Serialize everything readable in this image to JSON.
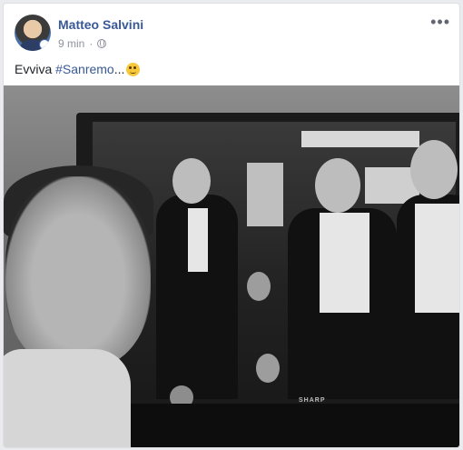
{
  "post": {
    "author": "Matteo Salvini",
    "time": "9 min",
    "separator": "·",
    "privacy_icon": "globe-icon",
    "more_icon": "more-options-icon",
    "text_before": "Evviva ",
    "hashtag": "#Sanremo",
    "text_after": "...",
    "emoji": "winking-face-emoji"
  },
  "photo": {
    "tv_brand": "SHARP"
  },
  "colors": {
    "link": "#385898",
    "meta": "#90949c",
    "text": "#1d2129",
    "background": "#e9ebee"
  }
}
